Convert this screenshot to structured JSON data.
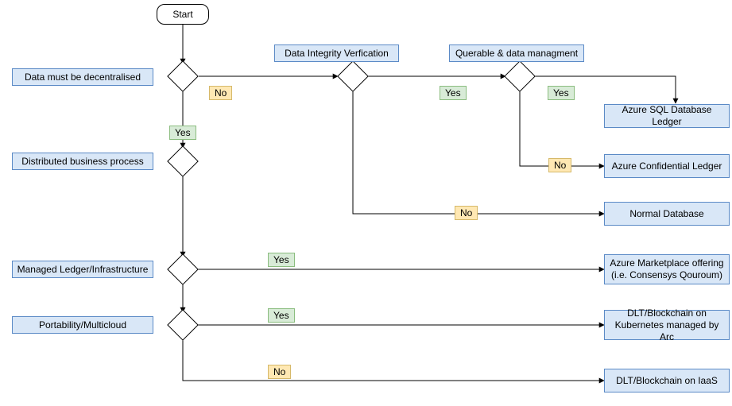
{
  "chart_data": {
    "type": "flowchart",
    "start": "Start",
    "decisions": [
      {
        "id": "decentralised",
        "label": "Data must be decentralised",
        "yes_to": "distributed",
        "no_to": "integrity"
      },
      {
        "id": "integrity",
        "label": "Data Integrity Verfication",
        "yes_to": "querable",
        "no_to": "normal_db"
      },
      {
        "id": "querable",
        "label": "Querable & data managment",
        "yes_to": "sql_ledger",
        "no_to": "conf_ledger"
      },
      {
        "id": "distributed",
        "label": "Distributed business process",
        "down_to": "managed"
      },
      {
        "id": "managed",
        "label": "Managed Ledger/Infrastructure",
        "yes_to": "marketplace",
        "down_to": "portability"
      },
      {
        "id": "portability",
        "label": "Portability/Multicloud",
        "yes_to": "dlt_k8s",
        "no_to": "dlt_iaas"
      }
    ],
    "outcomes": {
      "sql_ledger": "Azure SQL Database Ledger",
      "conf_ledger": "Azure Confidential Ledger",
      "normal_db": "Normal Database",
      "marketplace": "Azure Marketplace offering (i.e. Consensys Qouroum)",
      "dlt_k8s": "DLT/Blockchain on Kubernetes managed by Arc",
      "dlt_iaas": "DLT/Blockchain on IaaS"
    },
    "edge_labels": {
      "yes": "Yes",
      "no": "No"
    }
  },
  "start_label": "Start",
  "q_decentralised": "Data must be decentralised",
  "q_integrity": "Data Integrity Verfication",
  "q_querable": "Querable & data managment",
  "q_distributed": "Distributed business process",
  "q_managed": "Managed Ledger/Infrastructure",
  "q_portability": "Portability/Multicloud",
  "o_sql_ledger": "Azure SQL Database Ledger",
  "o_conf_ledger": "Azure Confidential Ledger",
  "o_normal_db": "Normal Database",
  "o_marketplace": "Azure Marketplace offering (i.e. Consensys Qouroum)",
  "o_dlt_k8s": "DLT/Blockchain on Kubernetes managed by Arc",
  "o_dlt_iaas": "DLT/Blockchain on IaaS",
  "yes": "Yes",
  "no": "No"
}
